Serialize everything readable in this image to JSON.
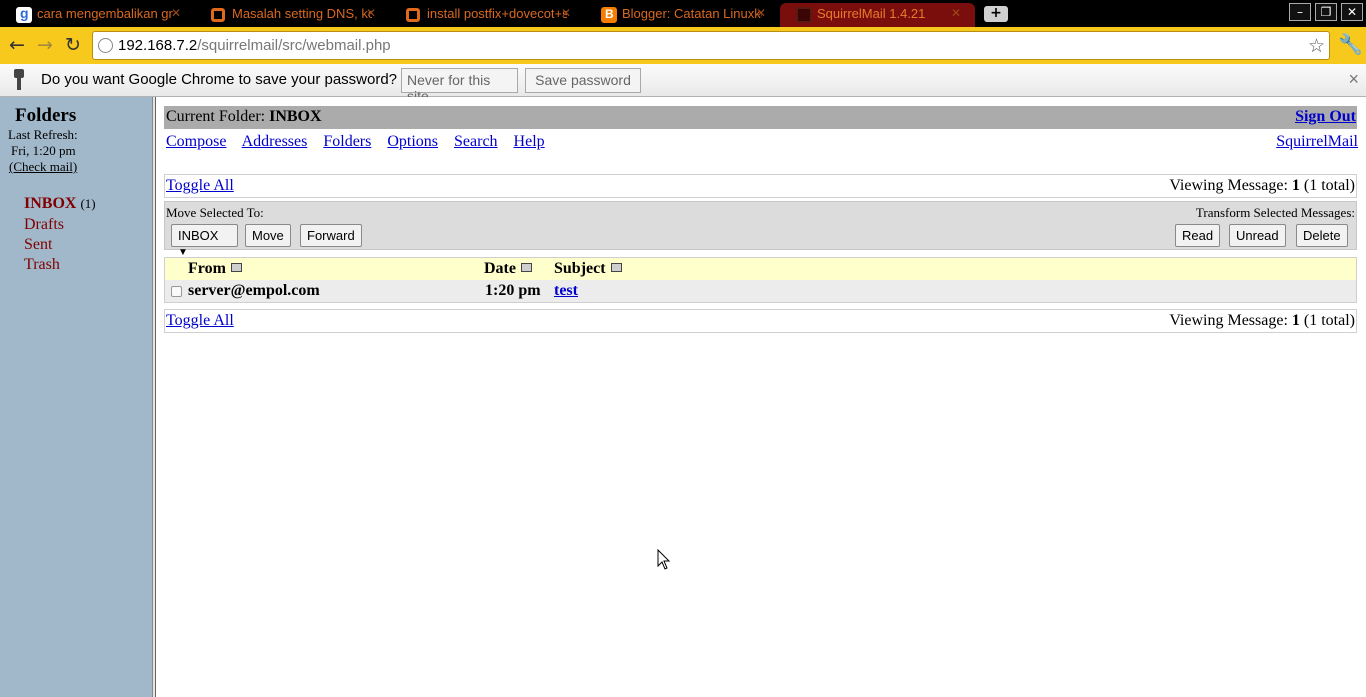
{
  "browser": {
    "tabs": [
      {
        "title": "cara mengembalikan gr",
        "icon": "google-icon"
      },
      {
        "title": "Masalah setting DNS, kok",
        "icon": "ubuntu-icon"
      },
      {
        "title": "install postfix+dovecot+s",
        "icon": "ubuntu-icon"
      },
      {
        "title": "Blogger: Catatan Linuxku",
        "icon": "blogger-icon"
      },
      {
        "title": "SquirrelMail 1.4.21",
        "icon": "squirrelmail-icon",
        "active": true
      }
    ],
    "new_tab_label": "+",
    "url_host": "192.168.7.2",
    "url_path": "/squirrelmail/src/webmail.php",
    "toolbar_color": "#f7c91d",
    "tabstrip_color": "#000000"
  },
  "infobar": {
    "message": "Do you want Google Chrome to save your password?",
    "never_label": "Never for this site",
    "save_label": "Save password",
    "close_label": "×"
  },
  "sidebar": {
    "title": "Folders",
    "last_refresh_label": "Last Refresh:",
    "refresh_time": "Fri, 1:20 pm",
    "check_mail": "(Check mail)",
    "folders": [
      {
        "name": "INBOX",
        "count": "(1)"
      },
      {
        "name": "Drafts"
      },
      {
        "name": "Sent"
      },
      {
        "name": "Trash"
      }
    ],
    "background": "#a1b8cb",
    "folder_color": "#800000"
  },
  "main": {
    "current_folder_label": "Current Folder: ",
    "current_folder": "INBOX",
    "sign_out": "Sign Out",
    "menu": [
      "Compose",
      "Addresses",
      "Folders",
      "Options",
      "Search",
      "Help"
    ],
    "squirrelmail_link": "SquirrelMail",
    "toggle_all": "Toggle All",
    "viewing_prefix": "Viewing Message: ",
    "viewing_number": "1",
    "viewing_total": " (1 total)",
    "move_selected_label": "Move Selected To:",
    "transform_label": "Transform Selected Messages:",
    "folder_select_value": "INBOX",
    "move_button": "Move",
    "forward_button": "Forward",
    "read_button": "Read",
    "unread_button": "Unread",
    "delete_button": "Delete",
    "columns": {
      "from": "From",
      "date": "Date",
      "subject": "Subject"
    },
    "messages": [
      {
        "from": "server@empol.com",
        "date": "1:20 pm",
        "subject": "test"
      }
    ],
    "link_color": "#0000cc"
  }
}
